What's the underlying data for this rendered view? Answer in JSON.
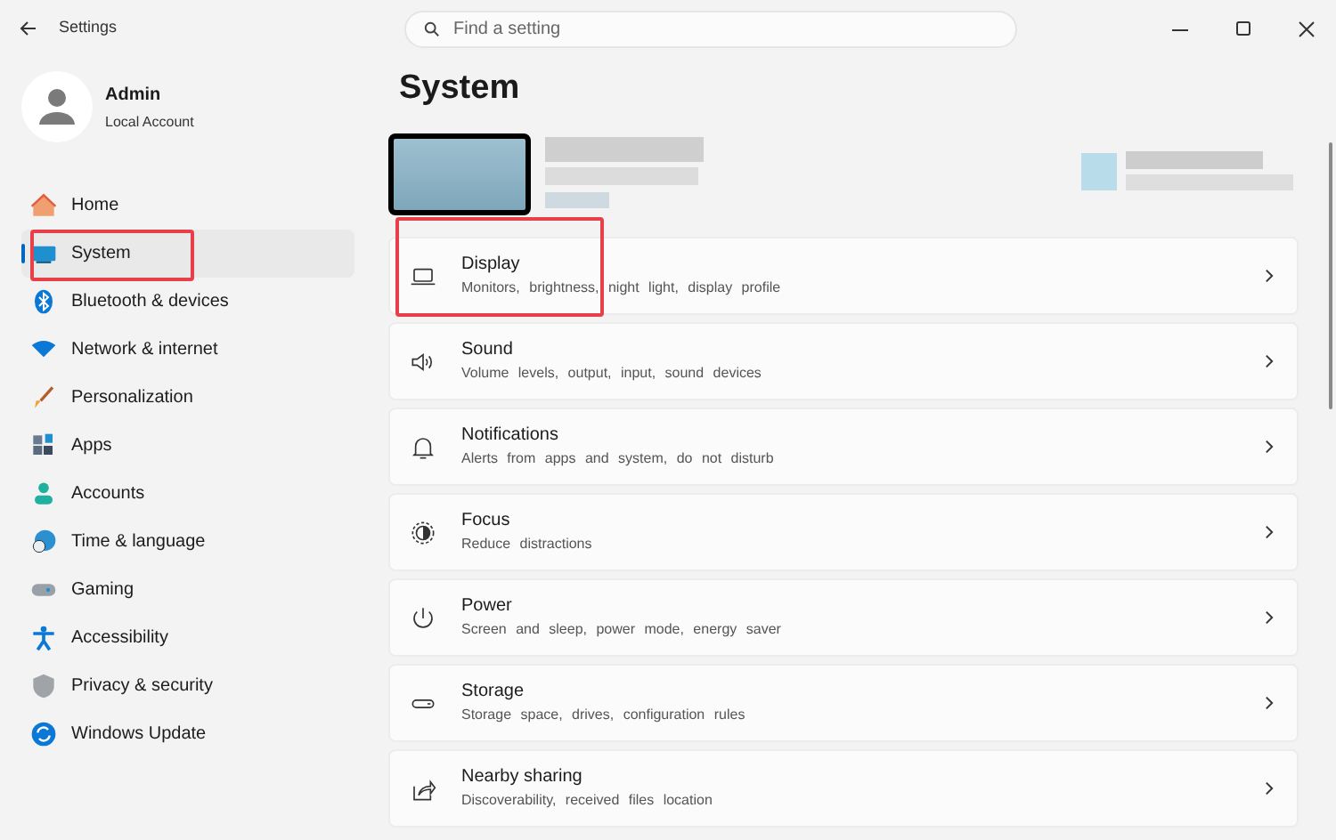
{
  "window": {
    "title": "Settings"
  },
  "search": {
    "placeholder": "Find a setting"
  },
  "account": {
    "name": "Admin",
    "type": "Local Account"
  },
  "sidebar": {
    "items": [
      {
        "label": "Home",
        "selected": false,
        "highlighted": false
      },
      {
        "label": "System",
        "selected": true,
        "highlighted": true
      },
      {
        "label": "Bluetooth & devices",
        "selected": false,
        "highlighted": false
      },
      {
        "label": "Network & internet",
        "selected": false,
        "highlighted": false
      },
      {
        "label": "Personalization",
        "selected": false,
        "highlighted": false
      },
      {
        "label": "Apps",
        "selected": false,
        "highlighted": false
      },
      {
        "label": "Accounts",
        "selected": false,
        "highlighted": false
      },
      {
        "label": "Time & language",
        "selected": false,
        "highlighted": false
      },
      {
        "label": "Gaming",
        "selected": false,
        "highlighted": false
      },
      {
        "label": "Accessibility",
        "selected": false,
        "highlighted": false
      },
      {
        "label": "Privacy & security",
        "selected": false,
        "highlighted": false
      },
      {
        "label": "Windows Update",
        "selected": false,
        "highlighted": false
      }
    ]
  },
  "page": {
    "title": "System"
  },
  "settings": [
    {
      "title": "Display",
      "description": "Monitors, brightness, night light, display profile",
      "highlighted": true
    },
    {
      "title": "Sound",
      "description": "Volume levels, output, input, sound devices",
      "highlighted": false
    },
    {
      "title": "Notifications",
      "description": "Alerts from apps and system, do not disturb",
      "highlighted": false
    },
    {
      "title": "Focus",
      "description": "Reduce distractions",
      "highlighted": false
    },
    {
      "title": "Power",
      "description": "Screen and sleep, power mode, energy saver",
      "highlighted": false
    },
    {
      "title": "Storage",
      "description": "Storage space, drives, configuration rules",
      "highlighted": false
    },
    {
      "title": "Nearby sharing",
      "description": "Discoverability, received files location",
      "highlighted": false
    }
  ]
}
